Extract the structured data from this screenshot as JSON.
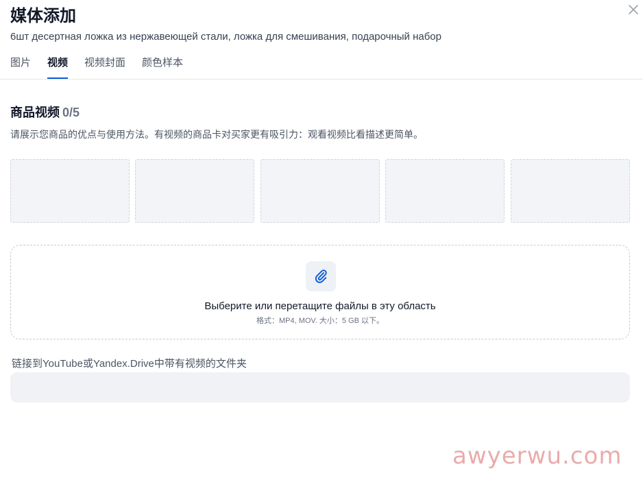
{
  "dialog": {
    "title": "媒体添加",
    "subtitle": "6шт десертная ложка из нержавеющей стали, ложка для смешивания, подарочный набор",
    "close_icon": "close-icon"
  },
  "tabs": [
    {
      "label": "图片",
      "active": false
    },
    {
      "label": "视频",
      "active": true
    },
    {
      "label": "视频封面",
      "active": false
    },
    {
      "label": "颜色样本",
      "active": false
    }
  ],
  "video_section": {
    "title": "商品视频",
    "count": "0/5",
    "description": "请展示您商品的优点与使用方法。有视频的商品卡对买家更有吸引力：观看视频比看描述更简单。",
    "slot_count": 5
  },
  "dropzone": {
    "icon": "paperclip-icon",
    "main_text": "Выберите или перетащите файлы в эту область",
    "hint_text": "格式：MP4, MOV. 大小：5 GB 以下。"
  },
  "link_field": {
    "label": "链接到YouTube或Yandex.Drive中带有视频的文件夹",
    "value": "",
    "placeholder": ""
  },
  "watermark": "awyerwu.com",
  "colors": {
    "accent": "#0b5cd6",
    "slot_bg": "#f2f4f7",
    "input_bg": "#f0f2f5"
  }
}
